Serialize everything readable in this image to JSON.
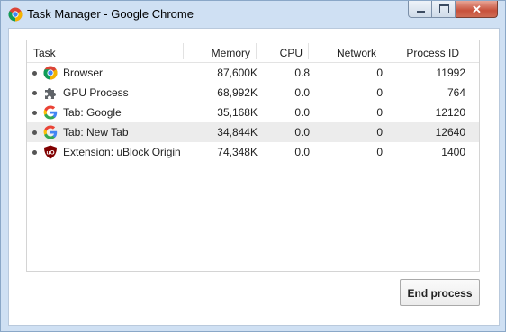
{
  "window": {
    "title": "Task Manager - Google Chrome"
  },
  "table": {
    "columns": [
      "Task",
      "Memory",
      "CPU",
      "Network",
      "Process ID"
    ],
    "rows": [
      {
        "icon": "chrome-icon",
        "name": "Browser",
        "memory": "87,600K",
        "cpu": "0.8",
        "network": "0",
        "pid": "11992",
        "selected": false
      },
      {
        "icon": "puzzle-icon",
        "name": "GPU Process",
        "memory": "68,992K",
        "cpu": "0.0",
        "network": "0",
        "pid": "764",
        "selected": false
      },
      {
        "icon": "google-g-icon",
        "name": "Tab: Google",
        "memory": "35,168K",
        "cpu": "0.0",
        "network": "0",
        "pid": "12120",
        "selected": false
      },
      {
        "icon": "google-g-icon",
        "name": "Tab: New Tab",
        "memory": "34,844K",
        "cpu": "0.0",
        "network": "0",
        "pid": "12640",
        "selected": true
      },
      {
        "icon": "ublock-origin-icon",
        "name": "Extension: uBlock Origin",
        "memory": "74,348K",
        "cpu": "0.0",
        "network": "0",
        "pid": "1400",
        "selected": false
      }
    ]
  },
  "actions": {
    "end_process_label": "End process"
  },
  "colors": {
    "titlebar": "#cfe0f3",
    "selected_row": "#ececec",
    "close_button": "#c7513b"
  }
}
